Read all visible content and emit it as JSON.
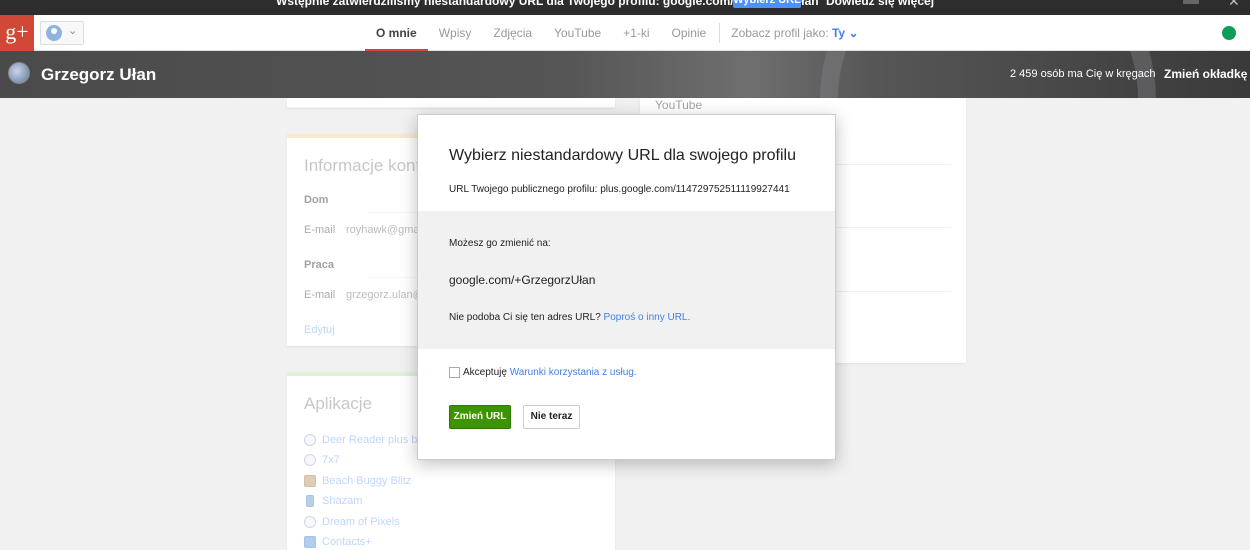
{
  "notification": {
    "text": "Wstępnie zatwierdziliśmy niestandardowy URL dla Twojego profilu: google.com/+GrzegorzUłan",
    "choose_button": "Wybierz URL",
    "learn_more": "Dowiedz się więcej"
  },
  "topbar": {
    "logo": "g+",
    "tabs": [
      {
        "label": "O mnie",
        "active": true
      },
      {
        "label": "Wpisy"
      },
      {
        "label": "Zdjęcia"
      },
      {
        "label": "YouTube"
      },
      {
        "label": "+1-ki"
      },
      {
        "label": "Opinie"
      }
    ],
    "view_as_label": "Zobacz profil jako:",
    "view_as_value": "Ty"
  },
  "cover": {
    "name": "Grzegorz Ułan",
    "circles": "2 459 osób ma Cię w kręgach",
    "change_cover": "Zmień okładkę"
  },
  "info_card": {
    "title": "Informacje kontaktowe",
    "home_heading": "Dom",
    "home_email_label": "E-mail",
    "home_email_value": "royhawk@gmail.com",
    "work_heading": "Praca",
    "work_email_label": "E-mail",
    "work_email_value": "grzegorz.ulan@gmail.com",
    "edit": "Edytuj"
  },
  "apps_card": {
    "title": "Aplikacje",
    "items": [
      {
        "label": "Deer Reader plus but",
        "icon": "globe-icon"
      },
      {
        "label": "7x7",
        "icon": "globe-icon"
      },
      {
        "label": "Beach Buggy Blitz",
        "icon": "game-icon"
      },
      {
        "label": "Shazam",
        "icon": "phone-icon"
      },
      {
        "label": "Dream of Pixels",
        "icon": "globe-icon"
      },
      {
        "label": "Contacts+",
        "icon": "plus-icon"
      }
    ]
  },
  "right_card": {
    "youtube_heading": "YouTube"
  },
  "dialog": {
    "title": "Wybierz niestandardowy URL dla swojego profilu",
    "current_url": "URL Twojego publicznego profilu: plus.google.com/114729752511119927441",
    "change_label": "Możesz go zmienić na:",
    "proposed_url": "google.com/+GrzegorzUłan",
    "dislike_text": "Nie podoba Ci się ten adres URL?",
    "dislike_link": "Poproś o inny URL.",
    "terms_text": "Akceptuję",
    "terms_link": "Warunki korzystania z usług.",
    "confirm_button": "Zmień URL",
    "cancel_button": "Nie teraz"
  },
  "colors": {
    "brand_red": "#d14836",
    "link_blue": "#427fed",
    "confirm_green": "#3d9400"
  }
}
